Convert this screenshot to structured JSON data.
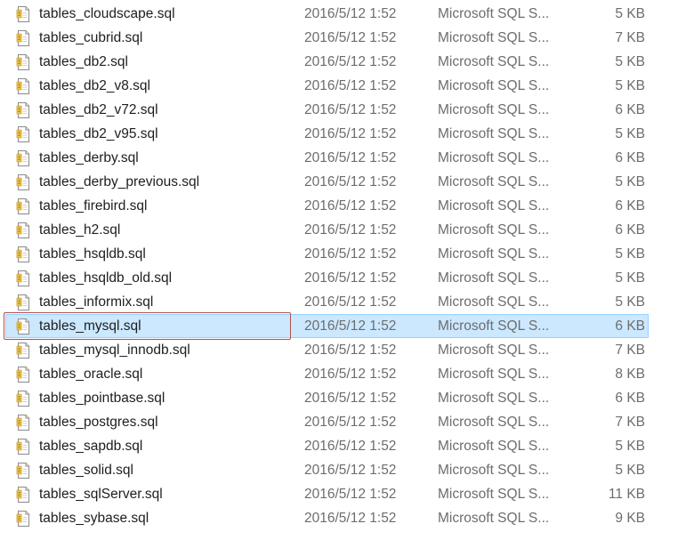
{
  "files": [
    {
      "name": "tables_cloudscape.sql",
      "date": "2016/5/12 1:52",
      "type": "Microsoft SQL S...",
      "size": "5 KB",
      "selected": false
    },
    {
      "name": "tables_cubrid.sql",
      "date": "2016/5/12 1:52",
      "type": "Microsoft SQL S...",
      "size": "7 KB",
      "selected": false
    },
    {
      "name": "tables_db2.sql",
      "date": "2016/5/12 1:52",
      "type": "Microsoft SQL S...",
      "size": "5 KB",
      "selected": false
    },
    {
      "name": "tables_db2_v8.sql",
      "date": "2016/5/12 1:52",
      "type": "Microsoft SQL S...",
      "size": "5 KB",
      "selected": false
    },
    {
      "name": "tables_db2_v72.sql",
      "date": "2016/5/12 1:52",
      "type": "Microsoft SQL S...",
      "size": "6 KB",
      "selected": false
    },
    {
      "name": "tables_db2_v95.sql",
      "date": "2016/5/12 1:52",
      "type": "Microsoft SQL S...",
      "size": "5 KB",
      "selected": false
    },
    {
      "name": "tables_derby.sql",
      "date": "2016/5/12 1:52",
      "type": "Microsoft SQL S...",
      "size": "6 KB",
      "selected": false
    },
    {
      "name": "tables_derby_previous.sql",
      "date": "2016/5/12 1:52",
      "type": "Microsoft SQL S...",
      "size": "5 KB",
      "selected": false
    },
    {
      "name": "tables_firebird.sql",
      "date": "2016/5/12 1:52",
      "type": "Microsoft SQL S...",
      "size": "6 KB",
      "selected": false
    },
    {
      "name": "tables_h2.sql",
      "date": "2016/5/12 1:52",
      "type": "Microsoft SQL S...",
      "size": "6 KB",
      "selected": false
    },
    {
      "name": "tables_hsqldb.sql",
      "date": "2016/5/12 1:52",
      "type": "Microsoft SQL S...",
      "size": "5 KB",
      "selected": false
    },
    {
      "name": "tables_hsqldb_old.sql",
      "date": "2016/5/12 1:52",
      "type": "Microsoft SQL S...",
      "size": "5 KB",
      "selected": false
    },
    {
      "name": "tables_informix.sql",
      "date": "2016/5/12 1:52",
      "type": "Microsoft SQL S...",
      "size": "5 KB",
      "selected": false
    },
    {
      "name": "tables_mysql.sql",
      "date": "2016/5/12 1:52",
      "type": "Microsoft SQL S...",
      "size": "6 KB",
      "selected": true
    },
    {
      "name": "tables_mysql_innodb.sql",
      "date": "2016/5/12 1:52",
      "type": "Microsoft SQL S...",
      "size": "7 KB",
      "selected": false
    },
    {
      "name": "tables_oracle.sql",
      "date": "2016/5/12 1:52",
      "type": "Microsoft SQL S...",
      "size": "8 KB",
      "selected": false
    },
    {
      "name": "tables_pointbase.sql",
      "date": "2016/5/12 1:52",
      "type": "Microsoft SQL S...",
      "size": "6 KB",
      "selected": false
    },
    {
      "name": "tables_postgres.sql",
      "date": "2016/5/12 1:52",
      "type": "Microsoft SQL S...",
      "size": "7 KB",
      "selected": false
    },
    {
      "name": "tables_sapdb.sql",
      "date": "2016/5/12 1:52",
      "type": "Microsoft SQL S...",
      "size": "5 KB",
      "selected": false
    },
    {
      "name": "tables_solid.sql",
      "date": "2016/5/12 1:52",
      "type": "Microsoft SQL S...",
      "size": "5 KB",
      "selected": false
    },
    {
      "name": "tables_sqlServer.sql",
      "date": "2016/5/12 1:52",
      "type": "Microsoft SQL S...",
      "size": "11 KB",
      "selected": false
    },
    {
      "name": "tables_sybase.sql",
      "date": "2016/5/12 1:52",
      "type": "Microsoft SQL S...",
      "size": "9 KB",
      "selected": false
    }
  ],
  "icon": "sql-file-icon",
  "colors": {
    "selection_bg": "#cce8ff",
    "selection_border": "#99d1ff",
    "focus_outline": "#b05050",
    "name_text": "#1e1e1e",
    "meta_text": "#6d6d6d"
  }
}
